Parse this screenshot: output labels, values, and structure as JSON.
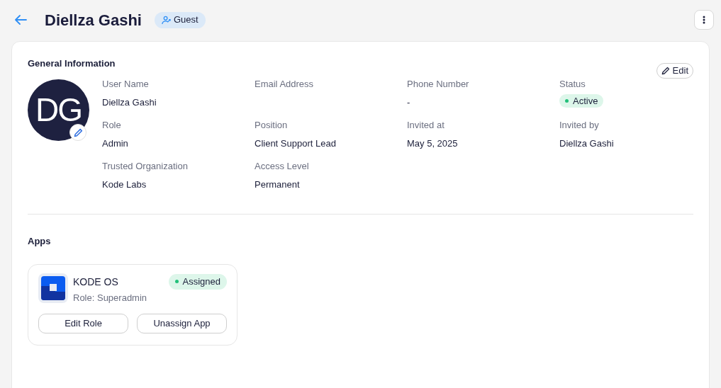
{
  "header": {
    "title": "Diellza Gashi",
    "role_badge": "Guest"
  },
  "general": {
    "title": "General Information",
    "edit_button": "Edit",
    "avatar_initials": "DG",
    "fields": [
      {
        "kind": "text",
        "label": "User Name",
        "value": "Diellza Gashi"
      },
      {
        "label": "Email Address"
      },
      {
        "kind": "text",
        "label": "Phone Number",
        "value": "-"
      },
      {
        "kind": "status",
        "label": "Status",
        "value": "Active"
      },
      {
        "kind": "text",
        "label": "Role",
        "value": "Admin"
      },
      {
        "kind": "text",
        "label": "Position",
        "value": "Client Support Lead"
      },
      {
        "kind": "text",
        "label": "Invited at",
        "value": "May 5, 2025"
      },
      {
        "kind": "text",
        "label": "Invited by",
        "value": "Diellza Gashi"
      },
      {
        "kind": "text",
        "label": "Trusted Organization",
        "value": "Kode Labs"
      },
      {
        "kind": "text",
        "label": "Access Level",
        "value": "Permanent"
      }
    ]
  },
  "apps": {
    "title": "Apps",
    "items": [
      {
        "name": "KODE OS",
        "role": "Role: Superadmin",
        "status": "Assigned",
        "buttons": [
          "Edit Role",
          "Unassign App"
        ]
      }
    ]
  }
}
